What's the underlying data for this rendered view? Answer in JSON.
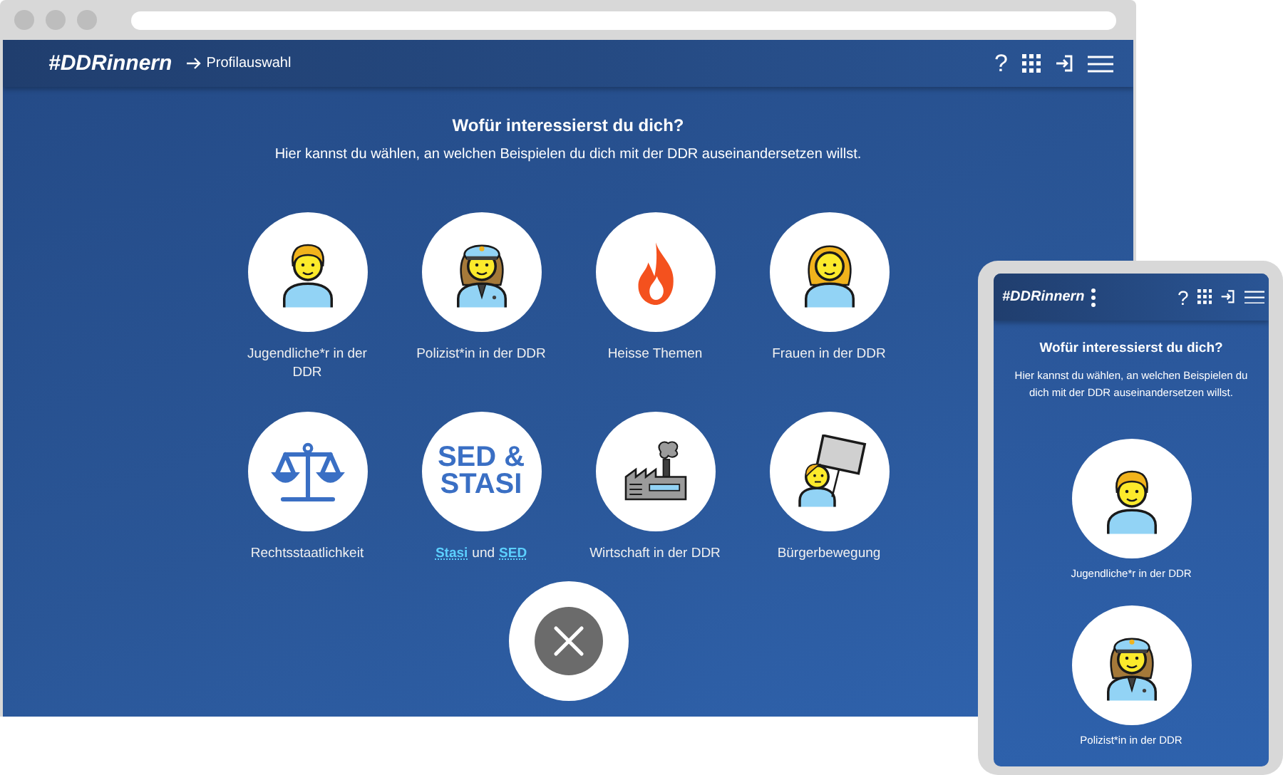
{
  "desktop": {
    "header": {
      "logo": "#DDRinnern",
      "breadcrumb": "Profilauswahl",
      "help": "?"
    },
    "heading": "Wofür interessierst du dich?",
    "intro": "Hier kannst du wählen, an welchen Beispielen du dich mit der DDR auseinandersetzen willst.",
    "profiles": [
      {
        "kind": "teen",
        "label": "Jugendliche*r in der DDR"
      },
      {
        "kind": "police",
        "label": "Polizist*in in der DDR"
      },
      {
        "kind": "fire",
        "label": "Heisse Themen"
      },
      {
        "kind": "woman",
        "label": "Frauen in der DDR"
      },
      {
        "kind": "scales",
        "label": "Rechtsstaatlichkeit"
      },
      {
        "kind": "text",
        "logo_lines": [
          "SED &",
          "STASI"
        ],
        "label_parts": [
          {
            "text": "Stasi",
            "link": true
          },
          {
            "text": "und",
            "link": false
          },
          {
            "text": "SED",
            "link": true
          }
        ]
      },
      {
        "kind": "factory",
        "label": "Wirtschaft in der DDR"
      },
      {
        "kind": "protest",
        "label": "Bürgerbewegung"
      }
    ]
  },
  "mobile": {
    "header": {
      "logo": "#DDRinnern",
      "help": "?"
    },
    "heading": "Wofür interessierst du dich?",
    "intro": "Hier kannst du wählen, an welchen Beispielen du dich mit der DDR auseinandersetzen willst.",
    "profiles": [
      {
        "kind": "teen",
        "label": "Jugendliche*r in der DDR"
      },
      {
        "kind": "police",
        "label": "Polizist*in in der DDR"
      }
    ]
  }
}
